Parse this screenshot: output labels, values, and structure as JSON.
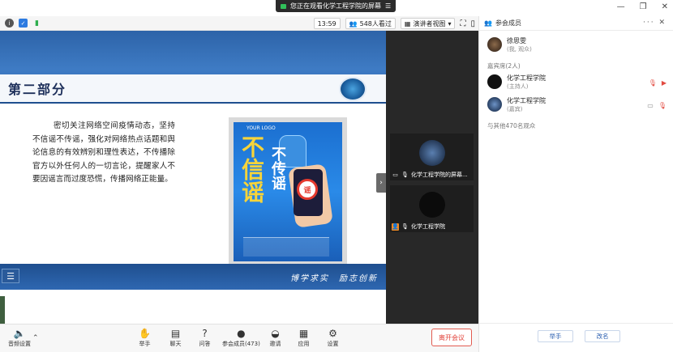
{
  "banner": {
    "text": "您正在观看化学工程学院的屏幕"
  },
  "window_controls": {
    "minimize": "—",
    "restore": "❐",
    "close": "✕"
  },
  "status": {
    "time": "13:59",
    "viewers": "548人看过",
    "view_mode": "演讲者视图"
  },
  "slide": {
    "title": "第二部分",
    "body": "密切关注网络空间疫情动态，坚持不信谣不传谣，强化对网络热点话题和舆论信息的有效辨别和理性表达，不传播除官方以外任何人的一切言论，提醒家人不要因谣言而过度恐慌，传播网络正能量。",
    "poster_big": "不信谣",
    "poster_small": "不传谣",
    "poster_logo": "YOUR LOGO",
    "motto": "博学求实　励志创新"
  },
  "video_tiles": [
    {
      "label": "化学工程学院的屏幕..."
    },
    {
      "label": "化学工程学院"
    }
  ],
  "toolbar": {
    "audio": "音频设置",
    "raise_hand": "举手",
    "chat": "聊天",
    "qa": "问答",
    "participants": "参会成员(473)",
    "invite": "邀请",
    "apps": "应用",
    "settings": "设置",
    "leave": "离开会议"
  },
  "panel": {
    "title": "参会成员",
    "self": {
      "name": "徐思雯",
      "role": "(我, 观众)"
    },
    "guest_section": "嘉宾席(2人)",
    "members": [
      {
        "name": "化学工程学院",
        "role": "(主持人)"
      },
      {
        "name": "化学工程学院",
        "role": "(嘉宾)"
      }
    ],
    "audience_note": "与其他470名观众",
    "raise_hand_btn": "举手",
    "rename_btn": "改名"
  }
}
